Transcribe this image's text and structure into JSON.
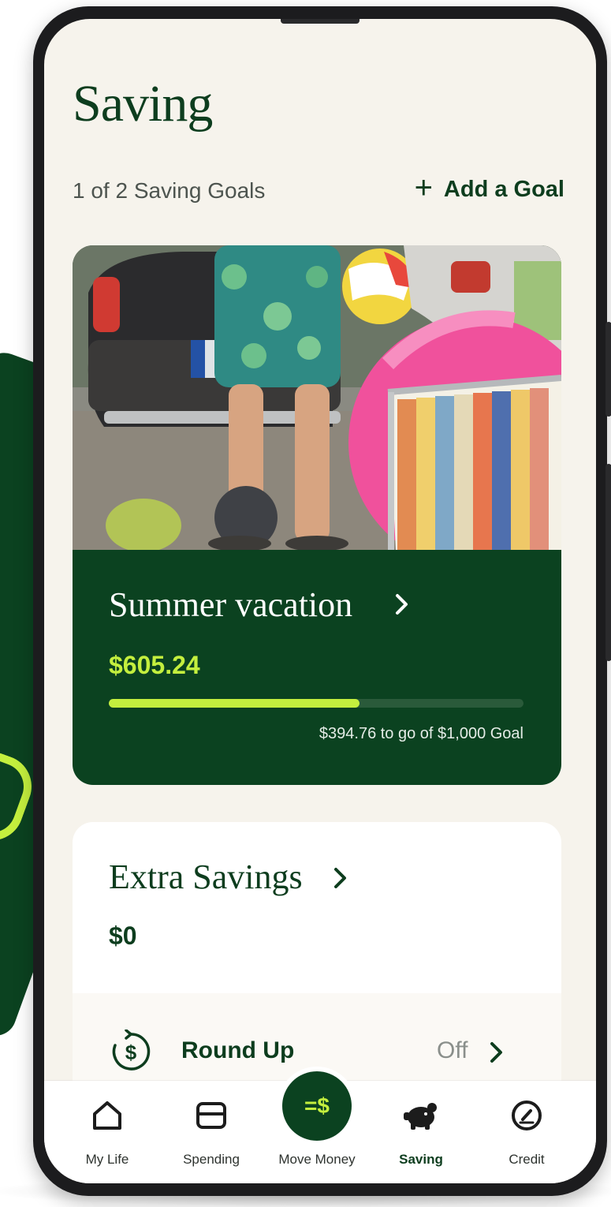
{
  "page": {
    "title": "Saving",
    "goals_count": "1 of 2 Saving Goals",
    "add_goal_label": "Add a Goal"
  },
  "goal": {
    "name": "Summer vacation",
    "amount": "$605.24",
    "progress_fraction": 0.605,
    "caption": "$394.76 to go of $1,000 Goal"
  },
  "extra_savings": {
    "title": "Extra Savings",
    "amount": "$0",
    "round_up": {
      "label": "Round Up",
      "status": "Off"
    }
  },
  "nav": {
    "items": [
      {
        "label": "My Life",
        "icon": "home-icon"
      },
      {
        "label": "Spending",
        "icon": "card-icon"
      },
      {
        "label": "Move Money",
        "icon": "move-money-icon",
        "fab_text": "=$"
      },
      {
        "label": "Saving",
        "icon": "piggy-bank-icon",
        "active": true
      },
      {
        "label": "Credit",
        "icon": "gauge-icon"
      }
    ]
  },
  "colors": {
    "brand_dark_green": "#0b4220",
    "accent_lime": "#c4ef3e",
    "background_cream": "#f6f3ec"
  }
}
